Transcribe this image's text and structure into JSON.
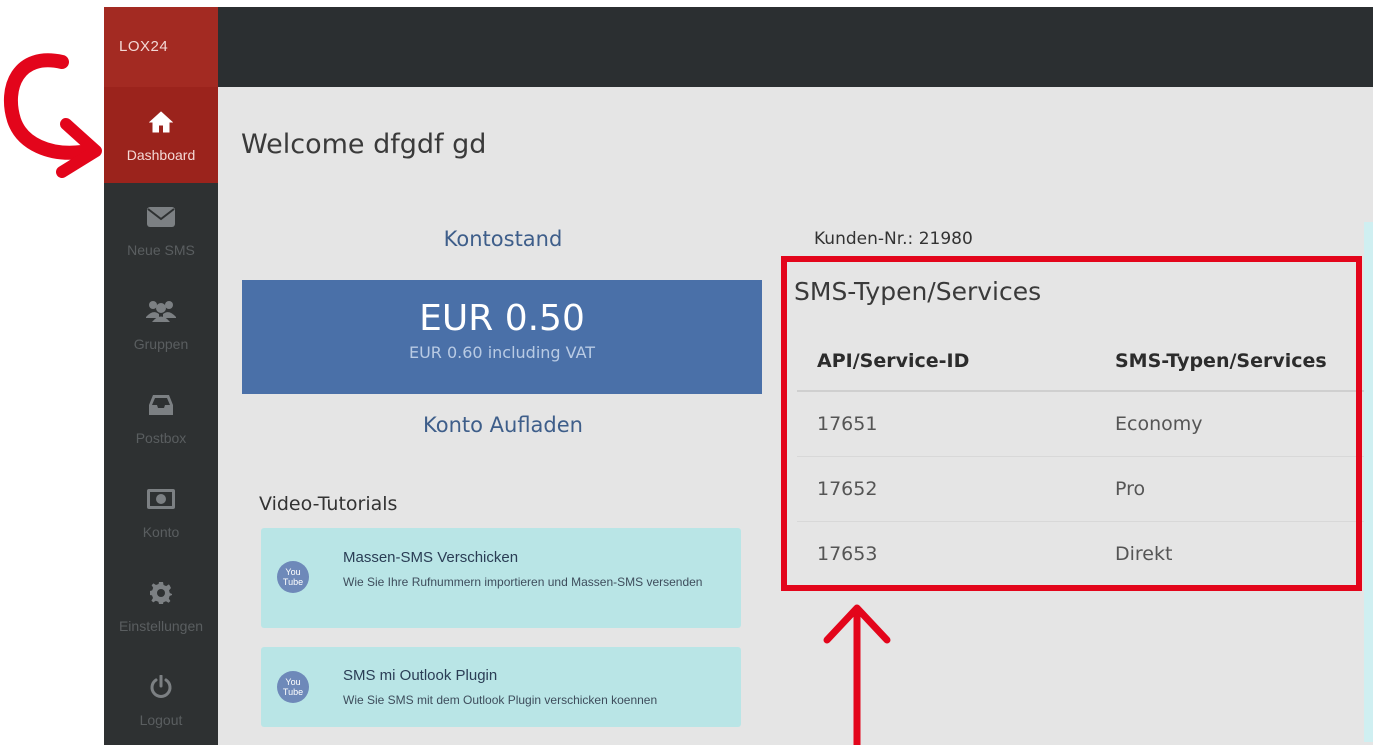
{
  "brand": "LOX24",
  "nav": [
    {
      "label": "Dashboard",
      "icon": "home-icon",
      "active": true
    },
    {
      "label": "Neue SMS",
      "icon": "envelope-icon"
    },
    {
      "label": "Gruppen",
      "icon": "users-icon"
    },
    {
      "label": "Postbox",
      "icon": "inbox-icon"
    },
    {
      "label": "Konto",
      "icon": "money-icon"
    },
    {
      "label": "Einstellungen",
      "icon": "gear-icon"
    },
    {
      "label": "Logout",
      "icon": "power-icon"
    }
  ],
  "main": {
    "welcome": "Welcome dfgdf gd",
    "balance_title": "Kontostand",
    "balance_amount": "EUR 0.50",
    "balance_vat": "EUR 0.60 including VAT",
    "topup": "Konto Aufladen",
    "video_title": "Video-Tutorials",
    "tutorials": [
      {
        "title": "Massen-SMS Verschicken",
        "desc": "Wie Sie Ihre Rufnummern importieren und Massen-SMS versenden",
        "icon": "youtube-icon",
        "icon_text": [
          "You",
          "Tube"
        ]
      },
      {
        "title": "SMS mi Outlook Plugin",
        "desc": "Wie Sie SMS mit dem Outlook Plugin verschicken koennen",
        "icon": "youtube-icon",
        "icon_text": [
          "You",
          "Tube"
        ]
      }
    ],
    "customer_no": "Kunden-Nr.: 21980",
    "services": {
      "title": "SMS-Typen/Services",
      "headers": [
        "API/Service-ID",
        "SMS-Typen/Services"
      ],
      "rows": [
        [
          "17651",
          "Economy"
        ],
        [
          "17652",
          "Pro"
        ],
        [
          "17653",
          "Direkt"
        ]
      ]
    }
  },
  "colors": {
    "sidebar": "#2e3132",
    "brand_bg": "#a32a22",
    "active_nav": "#9b231c",
    "balance_card": "#4a70a8",
    "tutorial_bg": "#b9e5e6",
    "annotation_red": "#e3051b"
  },
  "annotations": [
    "curved-arrow-icon",
    "up-arrow-icon"
  ]
}
